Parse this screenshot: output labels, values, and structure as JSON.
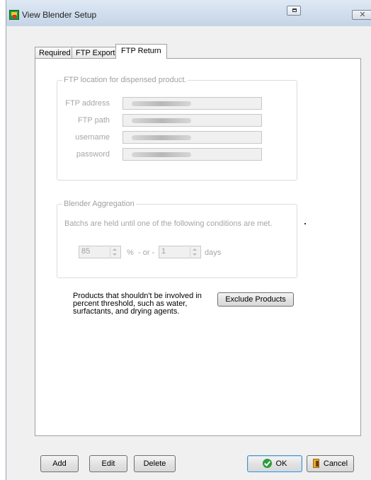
{
  "window": {
    "title": "View Blender Setup",
    "close_glyph": "✕"
  },
  "tabs": [
    {
      "label": "Required"
    },
    {
      "label": "FTP Export"
    },
    {
      "label": "FTP Return",
      "active": true
    }
  ],
  "ftp_group": {
    "legend": "FTP location for dispensed product.",
    "fields": [
      {
        "label": "FTP address",
        "value": ""
      },
      {
        "label": "FTP path",
        "value": ""
      },
      {
        "label": "username",
        "value": ""
      },
      {
        "label": "password",
        "value": ""
      }
    ]
  },
  "aggregation_group": {
    "legend": "Blender Aggregation",
    "description": "Batchs are held until one of the following conditions are met.",
    "percent_value": "85",
    "percent_unit": "%",
    "or_text": "- or -",
    "days_value": "1",
    "days_unit": "days"
  },
  "exclude": {
    "note": "Products that shouldn't be involved in percent threshold, such as water, surfactants,  and drying agents.",
    "button_label": "Exclude Products"
  },
  "buttons": {
    "add": "Add",
    "edit": "Edit",
    "delete": "Delete",
    "ok": "OK",
    "cancel": "Cancel"
  },
  "icons": {
    "app": "blender-app-icon",
    "ok": "green-check-icon",
    "cancel": "exit-door-icon"
  }
}
